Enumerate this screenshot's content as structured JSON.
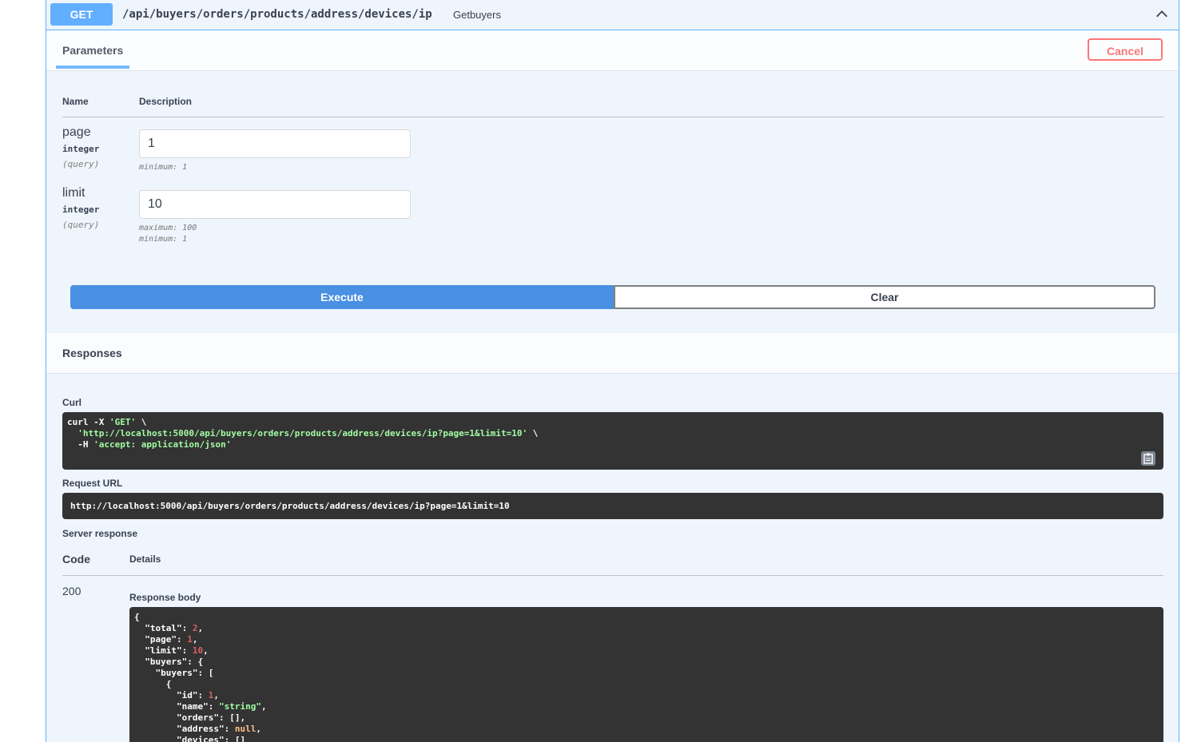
{
  "operation": {
    "method": "GET",
    "path": "/api/buyers/orders/products/address/devices/ip",
    "summary": "Getbuyers"
  },
  "tabs": {
    "parameters_label": "Parameters",
    "cancel_label": "Cancel"
  },
  "params_table": {
    "name_header": "Name",
    "description_header": "Description",
    "params": [
      {
        "name": "page",
        "type": "integer",
        "in": "(query)",
        "value": "1",
        "constraints": [
          "minimum: 1"
        ]
      },
      {
        "name": "limit",
        "type": "integer",
        "in": "(query)",
        "value": "10",
        "constraints": [
          "maximum: 100",
          "minimum: 1"
        ]
      }
    ]
  },
  "actions": {
    "execute_label": "Execute",
    "clear_label": "Clear"
  },
  "responses": {
    "title": "Responses",
    "curl_label": "Curl",
    "curl": {
      "line1_prefix": "curl -X ",
      "line1_method": "'GET'",
      "line1_suffix": " \\",
      "line2_url": "'http://localhost:5000/api/buyers/orders/products/address/devices/ip?page=1&limit=10'",
      "line2_suffix": " \\",
      "line3_prefix": "  -H ",
      "line3_header": "'accept: application/json'"
    },
    "request_url_label": "Request URL",
    "request_url": "http://localhost:5000/api/buyers/orders/products/address/devices/ip?page=1&limit=10",
    "server_response_label": "Server response",
    "code_header": "Code",
    "details_header": "Details",
    "status_code": "200",
    "response_body_label": "Response body",
    "body": {
      "open": "{",
      "total_key": "  \"total\": ",
      "total_val": "2",
      "page_key": "  \"page\": ",
      "page_val": "1",
      "limit_key": "  \"limit\": ",
      "limit_val": "10",
      "buyers_key": "  \"buyers\": {",
      "buyers_inner_key": "    \"buyers\": [",
      "obj_open": "      {",
      "id_key": "        \"id\": ",
      "id_val": "1",
      "name_key": "        \"name\": ",
      "name_val": "\"string\"",
      "orders_line": "        \"orders\": [],",
      "address_key": "        \"address\": ",
      "address_val": "null",
      "devices_line": "        \"devices\": []"
    }
  }
}
